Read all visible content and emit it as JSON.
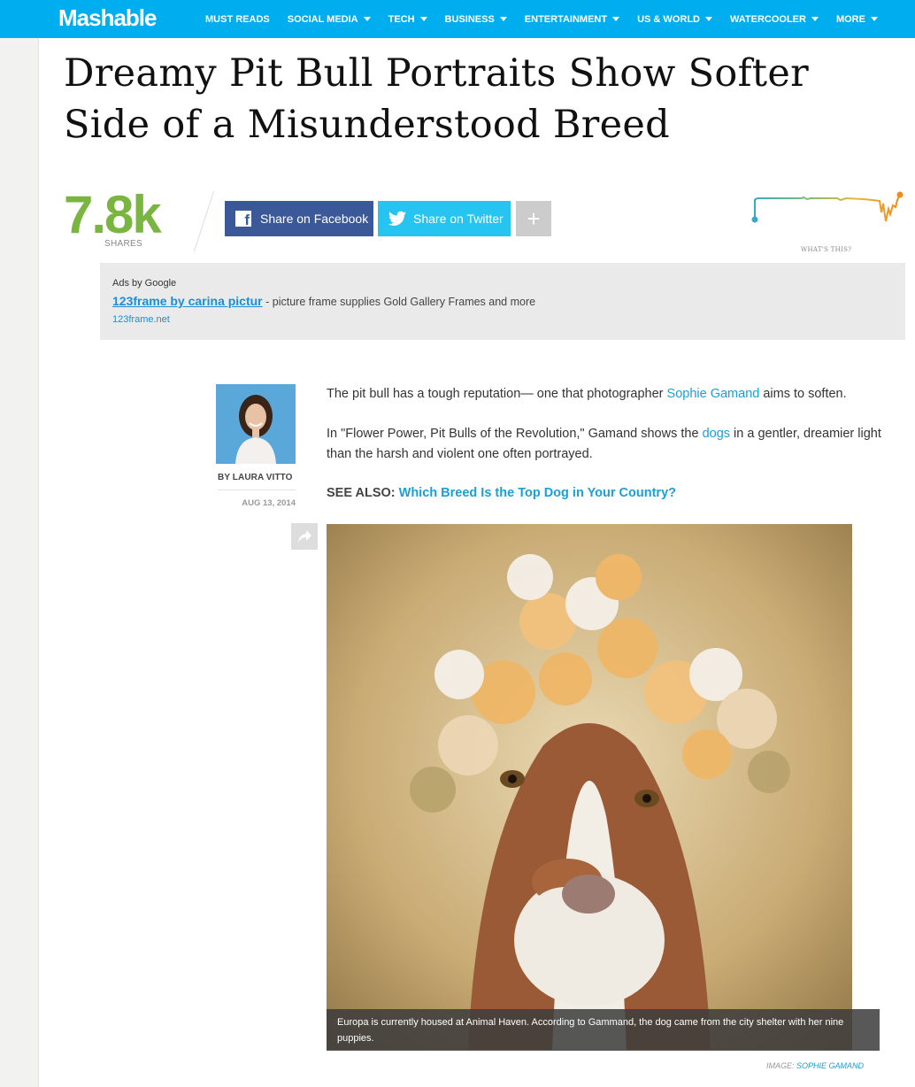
{
  "brand": {
    "logo": "Mashable",
    "nav_color": "#00aeef"
  },
  "nav": {
    "items": [
      {
        "label": "MUST READS",
        "dropdown": false
      },
      {
        "label": "SOCIAL MEDIA",
        "dropdown": true
      },
      {
        "label": "TECH",
        "dropdown": true
      },
      {
        "label": "BUSINESS",
        "dropdown": true
      },
      {
        "label": "ENTERTAINMENT",
        "dropdown": true
      },
      {
        "label": "US & WORLD",
        "dropdown": true
      },
      {
        "label": "WATERCOOLER",
        "dropdown": true
      },
      {
        "label": "MORE",
        "dropdown": true
      }
    ]
  },
  "article": {
    "headline": "Dreamy Pit Bull Portraits Show Softer Side of a Misunderstood Breed",
    "share_count": "7.8k",
    "shares_label": "SHARES",
    "facebook_label": "Share on Facebook",
    "twitter_label": "Share on Twitter",
    "more_label": "+",
    "velocity_link": "WHAT'S THIS?",
    "author": "BY LAURA VITTO",
    "date": "AUG 13, 2014",
    "para1_before": "The pit bull has a tough reputation— one that photographer ",
    "para1_link": "Sophie Gamand",
    "para1_after": " aims to soften.",
    "para2_before": "In \"Flower Power, Pit Bulls of the Revolution,\" Gamand shows the ",
    "para2_link": "dogs",
    "para2_after": " in a gentler, dreamier light than the harsh and violent one often portrayed.",
    "see_also_label": "SEE ALSO: ",
    "see_also_link": "Which Breed Is the Top Dog in Your Country?",
    "caption": "Europa is currently housed at Animal Haven. According to Gammand, the dog came from the city shelter with her nine puppies.",
    "credit_label": "IMAGE: ",
    "credit_name": "SOPHIE GAMAND"
  },
  "ad": {
    "by": "Ads by Google",
    "link": "123frame by carina pictur",
    "text": " - picture frame supplies Gold Gallery Frames and more",
    "url": "123frame.net"
  },
  "colors": {
    "facebook": "#3b5998",
    "twitter": "#26c4f1",
    "shares_green": "#7ab541",
    "link_blue": "#1a9fd6"
  },
  "icons": [
    "facebook-icon",
    "twitter-icon",
    "plus-icon",
    "share-arrow-icon",
    "chevron-down-icon"
  ]
}
